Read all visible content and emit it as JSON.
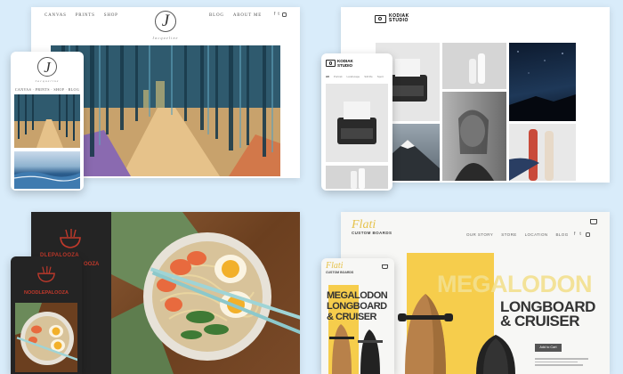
{
  "jacqueline": {
    "nav_left": [
      "CANVAS",
      "PRINTS",
      "SHOP"
    ],
    "nav_right": [
      "BLOG",
      "ABOUT ME"
    ],
    "logo_letter": "J",
    "logo_name": "Jacqueline",
    "mobile_nav": "CANVAS · PRINTS · SHOP · BLOG",
    "social_icons": [
      "facebook-icon",
      "twitter-icon",
      "instagram-icon"
    ]
  },
  "kodiak": {
    "brand_line1": "KODIAK",
    "brand_line2": "STUDIO",
    "mobile_tabs": [
      "All",
      "Portrait",
      "Landscape",
      "Still life",
      "Sport"
    ]
  },
  "noodle": {
    "brand_desktop": "DLEPALOOZA",
    "brand_partial": "OOZA",
    "brand_mobile": "NOODLEPALOOZA",
    "accent": "#c0392b"
  },
  "flati": {
    "brand_script": "Flati",
    "brand_sub": "CUSTOM BOARDS",
    "nav": [
      "OUR STORY",
      "STORE",
      "LOCATION",
      "BLOG"
    ],
    "headline_1": "MEGALODON",
    "headline_2": "LONGBOARD",
    "headline_3": "& CRUISER",
    "mobile_headline_1": "MEGALODON",
    "mobile_headline_2": "LONGBOARD",
    "mobile_headline_3": "& CRUISER",
    "cta": "Add to Cart",
    "accent": "#f6cd4c"
  }
}
